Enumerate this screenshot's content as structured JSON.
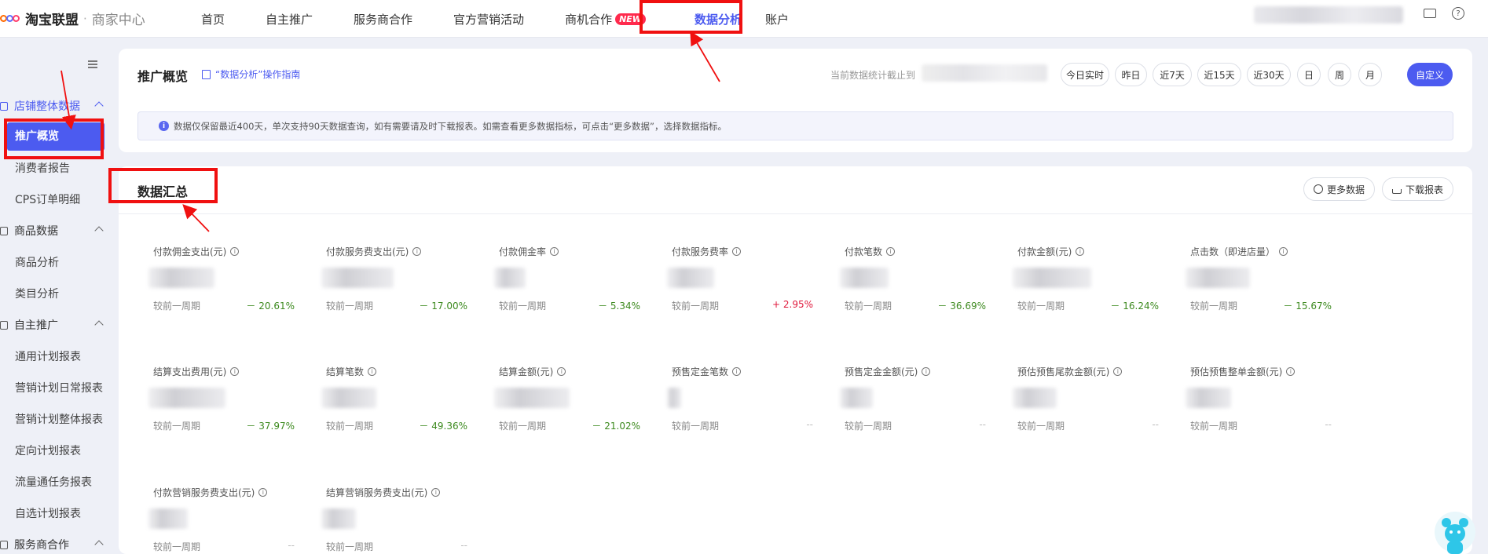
{
  "header": {
    "logo_text": "淘宝联盟",
    "logo_separator": "·",
    "logo_sub": "商家中心",
    "nav": [
      {
        "label": "首页",
        "active": false
      },
      {
        "label": "自主推广",
        "active": false
      },
      {
        "label": "服务商合作",
        "active": false
      },
      {
        "label": "官方营销活动",
        "active": false
      },
      {
        "label": "商机合作",
        "active": false,
        "badge": "NEW"
      },
      {
        "label": "数据分析",
        "active": true
      },
      {
        "label": "账户",
        "active": false
      }
    ]
  },
  "sidebar": {
    "groups": [
      {
        "label": "店铺整体数据",
        "items": [
          "推广概览",
          "消费者报告",
          "CPS订单明细"
        ]
      },
      {
        "label": "商品数据",
        "items": [
          "商品分析",
          "类目分析"
        ]
      },
      {
        "label": "自主推广",
        "items": [
          "通用计划报表",
          "营销计划日常报表",
          "营销计划整体报表",
          "定向计划报表",
          "流量通任务报表",
          "自选计划报表"
        ]
      },
      {
        "label": "服务商合作",
        "items": []
      }
    ],
    "active_item": "推广概览"
  },
  "overview": {
    "title": "推广概览",
    "guide_link": "“数据分析”操作指南",
    "stat_label": "当前数据统计截止到",
    "ranges": [
      "今日实时",
      "昨日",
      "近7天",
      "近15天",
      "近30天",
      "日",
      "周",
      "月",
      "自定义"
    ],
    "active_range": "自定义",
    "notice": "数据仅保留最近400天，单次支持90天数据查询，如有需要请及时下载报表。如需查看更多数据指标，可点击“更多数据”，选择数据指标。"
  },
  "summary": {
    "title": "数据汇总",
    "more_button": "更多数据",
    "download_button": "下载报表",
    "compare_label": "较前一周期",
    "metrics": [
      {
        "label": "付款佣金支出(元)",
        "change": "－ 20.61%",
        "dir": "down"
      },
      {
        "label": "付款服务费支出(元)",
        "change": "－ 17.00%",
        "dir": "down"
      },
      {
        "label": "付款佣金率",
        "change": "－ 5.34%",
        "dir": "down"
      },
      {
        "label": "付款服务费率",
        "change": "+ 2.95%",
        "dir": "up"
      },
      {
        "label": "付款笔数",
        "change": "－ 36.69%",
        "dir": "down"
      },
      {
        "label": "付款金额(元)",
        "change": "－ 16.24%",
        "dir": "down"
      },
      {
        "label": "点击数（即进店量）",
        "change": "－ 15.67%",
        "dir": "down"
      },
      {
        "label": "结算支出费用(元)",
        "change": "－ 37.97%",
        "dir": "down"
      },
      {
        "label": "结算笔数",
        "change": "－ 49.36%",
        "dir": "down"
      },
      {
        "label": "结算金额(元)",
        "change": "－ 21.02%",
        "dir": "down"
      },
      {
        "label": "预售定金笔数",
        "change": "--",
        "dir": "none"
      },
      {
        "label": "预售定金金额(元)",
        "change": "--",
        "dir": "none"
      },
      {
        "label": "预估预售尾款金额(元)",
        "change": "--",
        "dir": "none"
      },
      {
        "label": "预估预售整单金额(元)",
        "change": "--",
        "dir": "none"
      },
      {
        "label": "付款营销服务费支出(元)",
        "change": "--",
        "dir": "none"
      },
      {
        "label": "结算营销服务费支出(元)",
        "change": "--",
        "dir": "none"
      }
    ]
  },
  "colors": {
    "accent": "#4c5bf0",
    "annotation": "#f01010",
    "positive": "#e0193c",
    "negative": "#3d8a1f"
  }
}
